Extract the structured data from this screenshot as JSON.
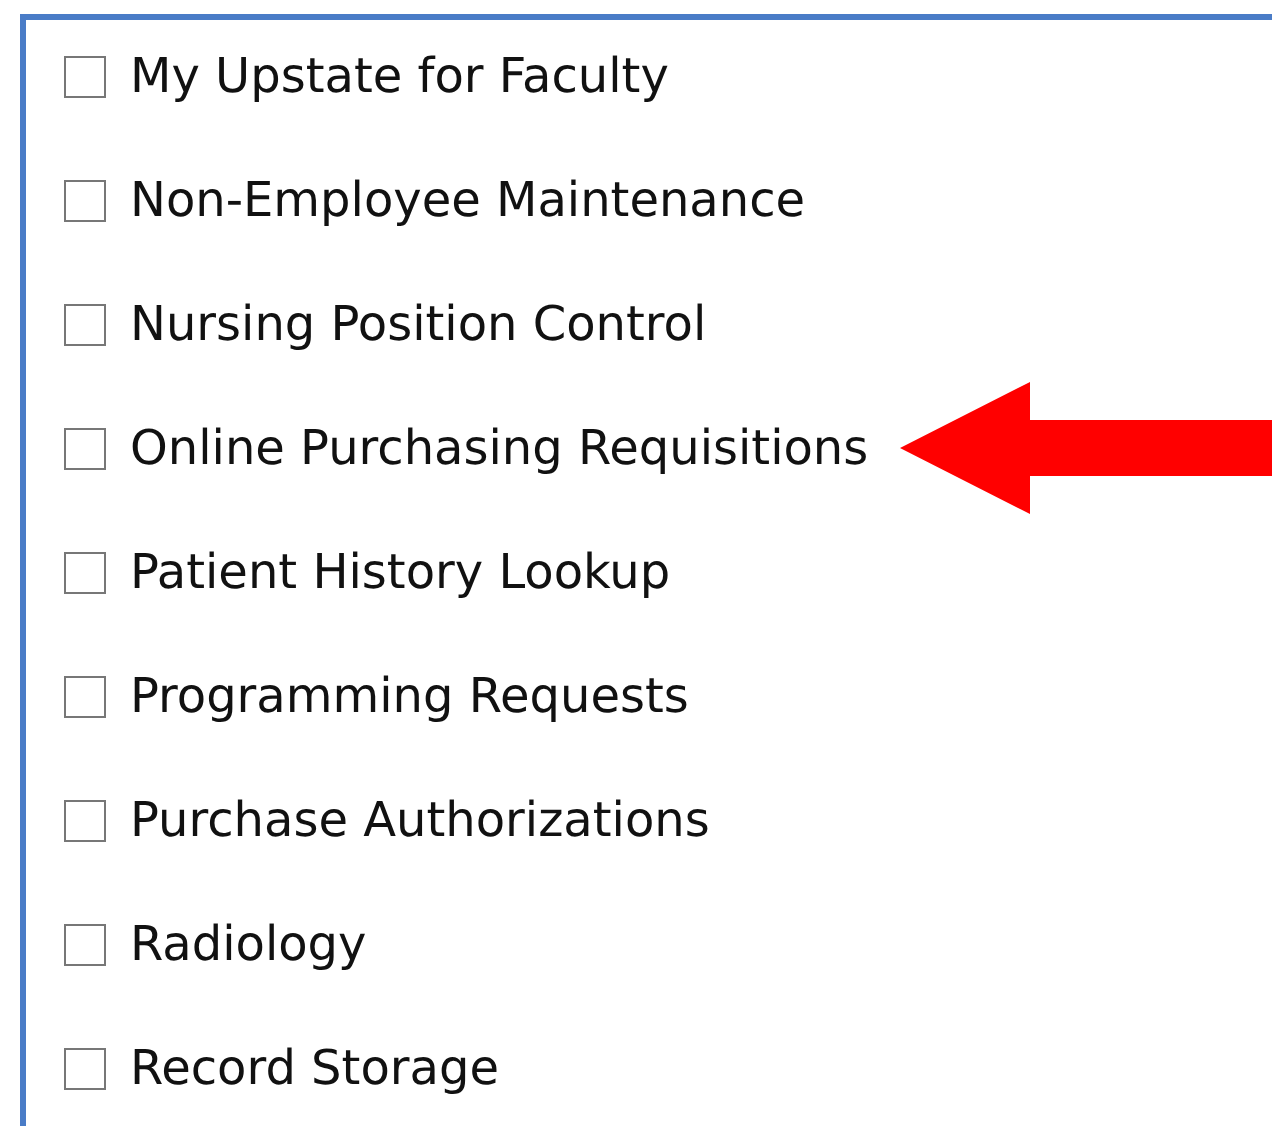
{
  "items": [
    {
      "label": "My Upstate for Faculty",
      "checked": false,
      "pointed_at": false
    },
    {
      "label": "Non-Employee Maintenance",
      "checked": false,
      "pointed_at": false
    },
    {
      "label": "Nursing Position Control",
      "checked": false,
      "pointed_at": false
    },
    {
      "label": "Online Purchasing Requisitions",
      "checked": false,
      "pointed_at": true
    },
    {
      "label": "Patient History Lookup",
      "checked": false,
      "pointed_at": false
    },
    {
      "label": "Programming Requests",
      "checked": false,
      "pointed_at": false
    },
    {
      "label": "Purchase Authorizations",
      "checked": false,
      "pointed_at": false
    },
    {
      "label": "Radiology",
      "checked": false,
      "pointed_at": false
    },
    {
      "label": "Record Storage",
      "checked": false,
      "pointed_at": false
    }
  ]
}
